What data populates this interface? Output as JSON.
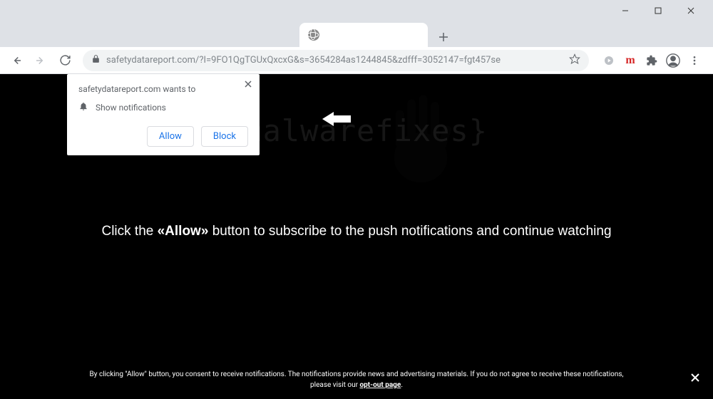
{
  "window": {
    "minimize": "—",
    "maximize": "□",
    "close": "✕"
  },
  "tab": {
    "title": ""
  },
  "toolbar": {
    "url": "safetydatareport.com/?I=9FO1QgTGUxQxcxG&s=3654284as1244845&zdfff=3052147=fgt457se"
  },
  "permission": {
    "wants_to": "safetydatareport.com wants to",
    "show_notifications": "Show notifications",
    "allow": "Allow",
    "block": "Block"
  },
  "page": {
    "watermark": "{malwarefixes}",
    "main_prefix": "Click the ",
    "main_allow": "«Allow»",
    "main_suffix": " button to subscribe to the push notifications and continue watching",
    "consent_line1": "By clicking \"Allow\" button, you consent to receive notifications. The notifications provide news and advertising materials. If you do not agree to receive these notifications,",
    "consent_line2a": "please visit our ",
    "consent_optout": "opt-out page",
    "consent_line2b": "."
  }
}
